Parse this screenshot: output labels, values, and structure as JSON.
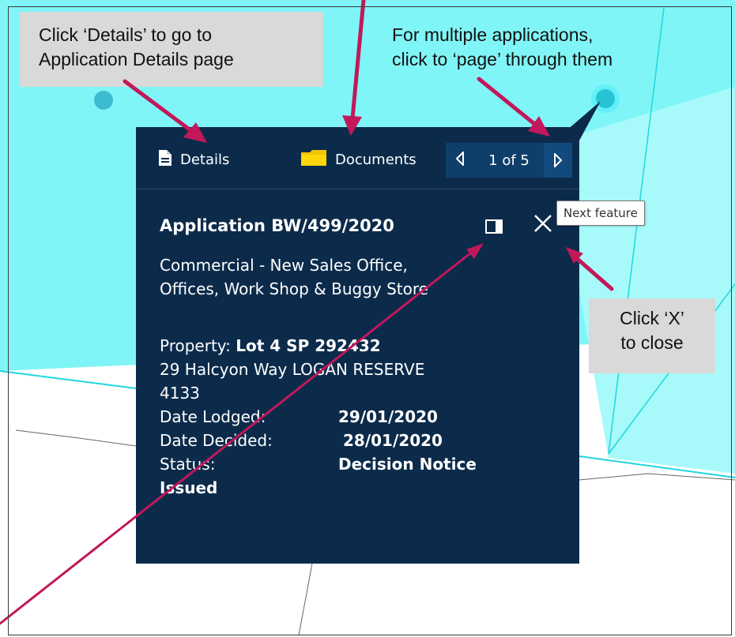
{
  "callouts": {
    "details": [
      "Click ‘Details’ to go to",
      "Application Details page"
    ],
    "pager": [
      "For multiple applications,",
      "click to ‘page’ through them"
    ],
    "close": [
      "Click ‘X’",
      "to close"
    ]
  },
  "popup": {
    "toolbar": {
      "details_label": "Details",
      "documents_label": "Documents",
      "pager_text": "1 of 5"
    },
    "title": "Application BW/499/2020",
    "description": [
      "Commercial - New Sales Office,",
      "Offices, Work Shop & Buggy Store"
    ],
    "property_label": "Property:",
    "property_value": "Lot 4 SP 292432",
    "address": [
      "29 Halcyon Way LOGAN RESERVE",
      "4133"
    ],
    "date_lodged_label": "Date Lodged:",
    "date_lodged_value": "29/01/2020",
    "date_decided_label": "Date Decided:",
    "date_decided_value": "28/01/2020",
    "status_label": "Status:",
    "status_value_line1": "Decision Notice",
    "status_value_line2": "Issued"
  },
  "tooltip": "Next feature",
  "icons": {
    "details": "document-icon",
    "documents": "folder-icon",
    "prev": "caret-left-icon",
    "next": "caret-right-icon",
    "dock": "dock-panel-icon",
    "close": "close-icon"
  },
  "colors": {
    "map_parcel": "#80f5f7",
    "map_parcel_light": "#a8fafa",
    "map_background": "#ffffff",
    "parcel_edge": "#1fd6de",
    "popup_bg": "#0c2b4b",
    "annotation_arrow": "#c2185b",
    "callout_bg": "#d9d9d9"
  }
}
